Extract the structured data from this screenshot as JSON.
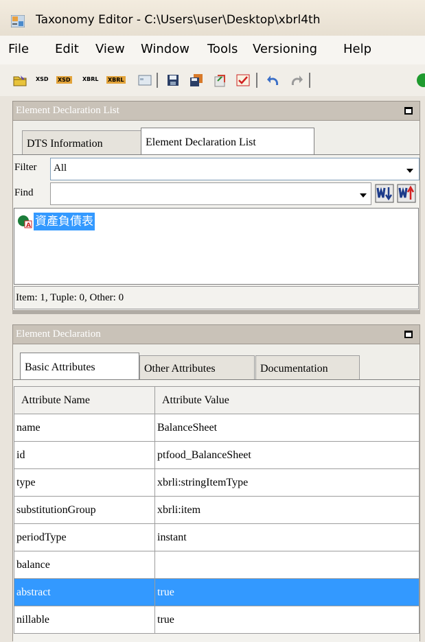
{
  "window": {
    "title": "Taxonomy Editor - C:\\Users\\user\\Desktop\\xbrl4th"
  },
  "menu": [
    "File",
    "Edit",
    "View",
    "Window",
    "Tools",
    "Versioning",
    "Help"
  ],
  "toolbar": {
    "labels": {
      "xsd1": "XSD",
      "xsd2": "XSD",
      "xbrl1": "XBRL",
      "xbrl2": "XBRL"
    }
  },
  "element_list_panel": {
    "title": "Element Declaration List",
    "tabs": [
      "DTS Information",
      "Element Declaration List"
    ],
    "active_tab": "Element Declaration List",
    "filter_label": "Filter",
    "filter_value": "All",
    "find_label": "Find",
    "find_value": "",
    "items": [
      {
        "label": "資產負債表",
        "selected": true
      }
    ],
    "status": "Item: 1, Tuple: 0, Other: 0"
  },
  "element_decl_panel": {
    "title": "Element Declaration",
    "tabs": [
      "Basic Attributes",
      "Other Attributes",
      "Documentation"
    ],
    "active_tab": "Basic Attributes",
    "columns": [
      "Attribute Name",
      "Attribute Value"
    ],
    "rows": [
      {
        "name": "name",
        "value": "BalanceSheet"
      },
      {
        "name": "id",
        "value": "ptfood_BalanceSheet"
      },
      {
        "name": "type",
        "value": "xbrli:stringItemType"
      },
      {
        "name": "substitutionGroup",
        "value": "xbrli:item"
      },
      {
        "name": "periodType",
        "value": "instant"
      },
      {
        "name": "balance",
        "value": ""
      },
      {
        "name": "abstract",
        "value": "true"
      },
      {
        "name": "nillable",
        "value": "true"
      }
    ],
    "selected_row": "abstract"
  }
}
